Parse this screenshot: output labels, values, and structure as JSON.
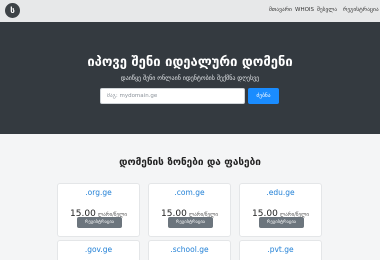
{
  "navbar": {
    "logo_glyph": "ს",
    "links": [
      "მთავარი",
      "WHOIS",
      "შესვლა",
      "რეგისტრაცია"
    ]
  },
  "hero": {
    "title": "იპოვე შენი იდეალური დომენი",
    "subtitle": "დაიწყე შენი ონლაინ იდენტობის შექმნა დღესვე",
    "search": {
      "placeholder": "მაგ: mydomain.ge",
      "value": ""
    },
    "search_button": "ძებნა"
  },
  "zones": {
    "title": "დომენის ზონები და ფასები",
    "items": [
      {
        "name": ".org.ge",
        "price": "15.00",
        "unit": "ლარი/წელი",
        "button": "რეგისტრაცია"
      },
      {
        "name": ".com.ge",
        "price": "15.00",
        "unit": "ლარი/წელი",
        "button": "რეგისტრაცია"
      },
      {
        "name": ".edu.ge",
        "price": "15.00",
        "unit": "ლარი/წელი",
        "button": "რეგისტრაცია"
      },
      {
        "name": ".gov.ge"
      },
      {
        "name": ".school.ge"
      },
      {
        "name": ".pvt.ge"
      }
    ]
  },
  "colors": {
    "navbar_bg": "#e7e8e9",
    "hero_bg": "#343a40",
    "accent": "#1a8cff",
    "zone_link": "#1f7fd6",
    "button_gray": "#6c757d"
  }
}
